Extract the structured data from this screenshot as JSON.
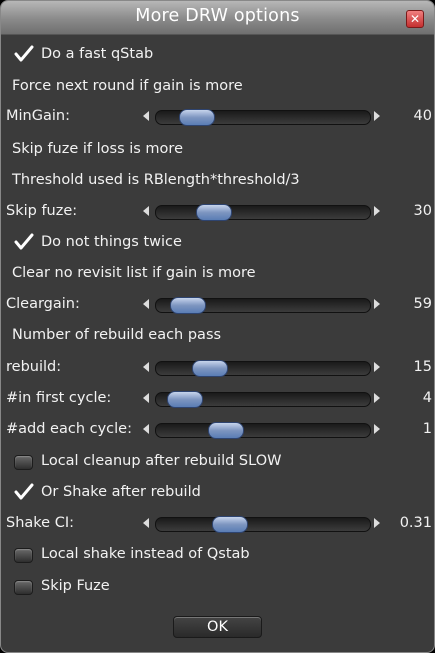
{
  "window": {
    "title": "More DRW  options",
    "close_icon": "close-icon"
  },
  "rows": {
    "fast_qstab": {
      "type": "checkbox",
      "label": "Do a fast qStab",
      "checked": true
    },
    "force_next_text": {
      "type": "text",
      "label": "Force next round if gain is more"
    },
    "mingain": {
      "type": "slider",
      "label": "MinGain:",
      "value": "40",
      "fraction": 0.13
    },
    "skip_fuze_text": {
      "type": "text",
      "label": "Skip fuze if loss is more"
    },
    "threshold_text": {
      "type": "text",
      "label": "Threshold used is RBlength*threshold/3"
    },
    "skip_fuze_slider": {
      "type": "slider",
      "label": "Skip fuze:",
      "value": "30",
      "fraction": 0.22
    },
    "not_twice": {
      "type": "checkbox",
      "label": "Do not things twice",
      "checked": true
    },
    "clear_text": {
      "type": "text",
      "label": "Clear no revisit list if gain is more"
    },
    "cleargain": {
      "type": "slider",
      "label": "Cleargain:",
      "value": "59",
      "fraction": 0.08
    },
    "rebuild_text": {
      "type": "text",
      "label": "Number of rebuild each pass"
    },
    "rebuild": {
      "type": "slider",
      "label": "rebuild:",
      "value": "15",
      "fraction": 0.2
    },
    "first_cycle": {
      "type": "slider",
      "label": "#in first cycle:",
      "value": "4",
      "fraction": 0.06
    },
    "add_cycle": {
      "type": "slider",
      "label": "#add each cycle:",
      "value": "1",
      "fraction": 0.29
    },
    "local_cleanup": {
      "type": "checkbox",
      "label": "Local cleanup after rebuild SLOW",
      "checked": false
    },
    "shake_after": {
      "type": "checkbox",
      "label": "Or Shake after rebuild",
      "checked": true
    },
    "shake_ci": {
      "type": "slider",
      "label": "Shake CI:",
      "value": "0.31",
      "fraction": 0.31
    },
    "local_shake": {
      "type": "checkbox",
      "label": "Local shake instead of Qstab",
      "checked": false
    },
    "skip_fuze_check": {
      "type": "checkbox",
      "label": "Skip Fuze",
      "checked": false
    }
  },
  "ok_button": {
    "label": "OK"
  },
  "colors": {
    "background": "#3b3b3b",
    "text": "#f2f2f2",
    "slider_thumb": "#7d95c0"
  }
}
